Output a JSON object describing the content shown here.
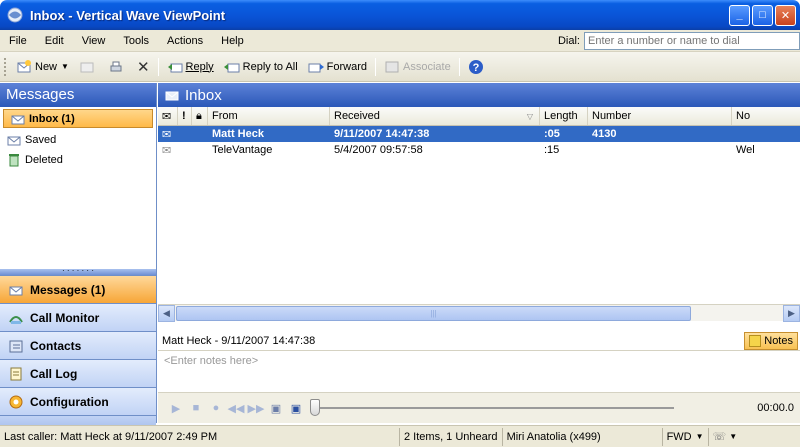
{
  "window": {
    "title": "Inbox - Vertical Wave ViewPoint"
  },
  "menu": {
    "items": [
      "File",
      "Edit",
      "View",
      "Tools",
      "Actions",
      "Help"
    ],
    "dial_label": "Dial:",
    "dial_placeholder": "Enter a number or name to dial"
  },
  "toolbar": {
    "new": "New",
    "reply": "Reply",
    "reply_all": "Reply to All",
    "forward": "Forward",
    "associate": "Associate"
  },
  "nav": {
    "header": "Messages",
    "folders": [
      {
        "label": "Inbox (1)",
        "icon": "inbox-icon"
      },
      {
        "label": "Saved",
        "icon": "saved-folder-icon"
      },
      {
        "label": "Deleted",
        "icon": "recycle-icon"
      }
    ],
    "sections": [
      {
        "label": "Messages (1)",
        "icon": "messages-icon"
      },
      {
        "label": "Call Monitor",
        "icon": "call-monitor-icon"
      },
      {
        "label": "Contacts",
        "icon": "contacts-icon"
      },
      {
        "label": "Call Log",
        "icon": "call-log-icon"
      },
      {
        "label": "Configuration",
        "icon": "configuration-icon"
      }
    ],
    "footer_chevron": "»"
  },
  "inbox": {
    "header": "Inbox",
    "columns": [
      "From",
      "Received",
      "Length",
      "Number",
      "No"
    ],
    "rows": [
      {
        "from": "Matt Heck",
        "received": "9/11/2007 14:47:38",
        "length": ":05",
        "number": "4130",
        "notes": ""
      },
      {
        "from": "TeleVantage",
        "received": "5/4/2007 09:57:58",
        "length": ":15",
        "number": "",
        "notes": "Wel"
      }
    ]
  },
  "notes": {
    "title": "Matt Heck - 9/11/2007 14:47:38",
    "button": "Notes",
    "placeholder": "<Enter notes here>"
  },
  "player": {
    "time": "00:00.0"
  },
  "status": {
    "last_caller": "Last caller: Matt Heck at 9/11/2007 2:49 PM",
    "counts": "2 Items, 1 Unheard",
    "user": "Miri Anatolia (x499)",
    "mode": "FWD"
  }
}
